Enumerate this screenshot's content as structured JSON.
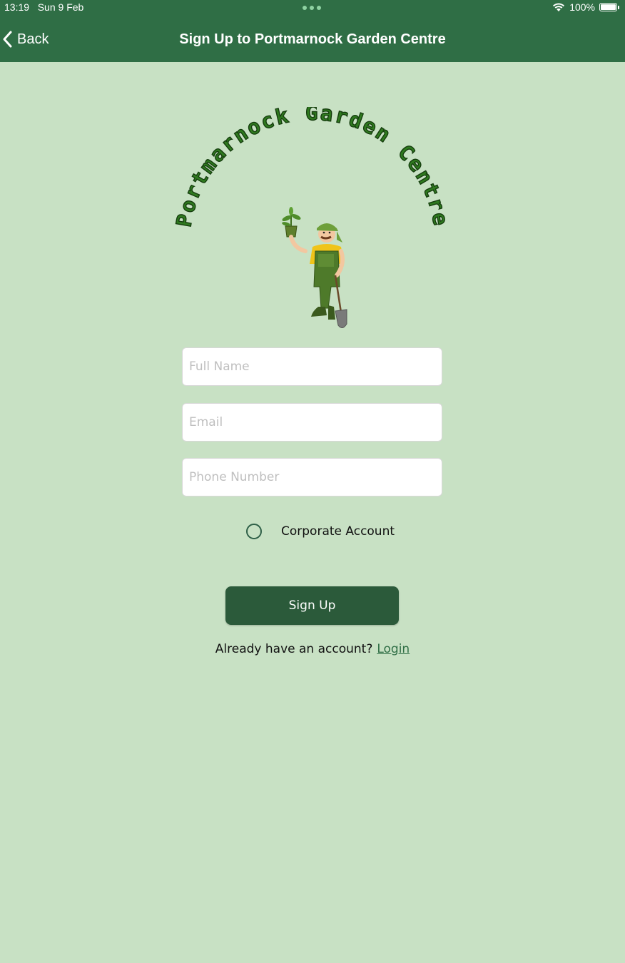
{
  "status_bar": {
    "time": "13:19",
    "date": "Sun 9 Feb",
    "battery": "100%",
    "icons": [
      "wifi-icon",
      "battery-icon"
    ]
  },
  "nav": {
    "back_label": "Back",
    "title": "Sign Up to Portmarnock Garden Centre",
    "back_icon": "chevron-left-icon"
  },
  "logo": {
    "text": "Portmarnock Garden Centre",
    "illustration": "gardener-holding-plant-and-shovel"
  },
  "form": {
    "full_name_placeholder": "Full Name",
    "email_placeholder": "Email",
    "phone_placeholder": "Phone Number",
    "corporate_label": "Corporate Account",
    "corporate_checked": false,
    "submit_label": "Sign Up"
  },
  "footer": {
    "prompt": "Already have an account?",
    "login_label": "Login"
  },
  "colors": {
    "nav_bar": "#2f6e45",
    "background": "#c8e1c4",
    "button": "#2b5a3a",
    "logo_text": "#2f7a1f"
  }
}
